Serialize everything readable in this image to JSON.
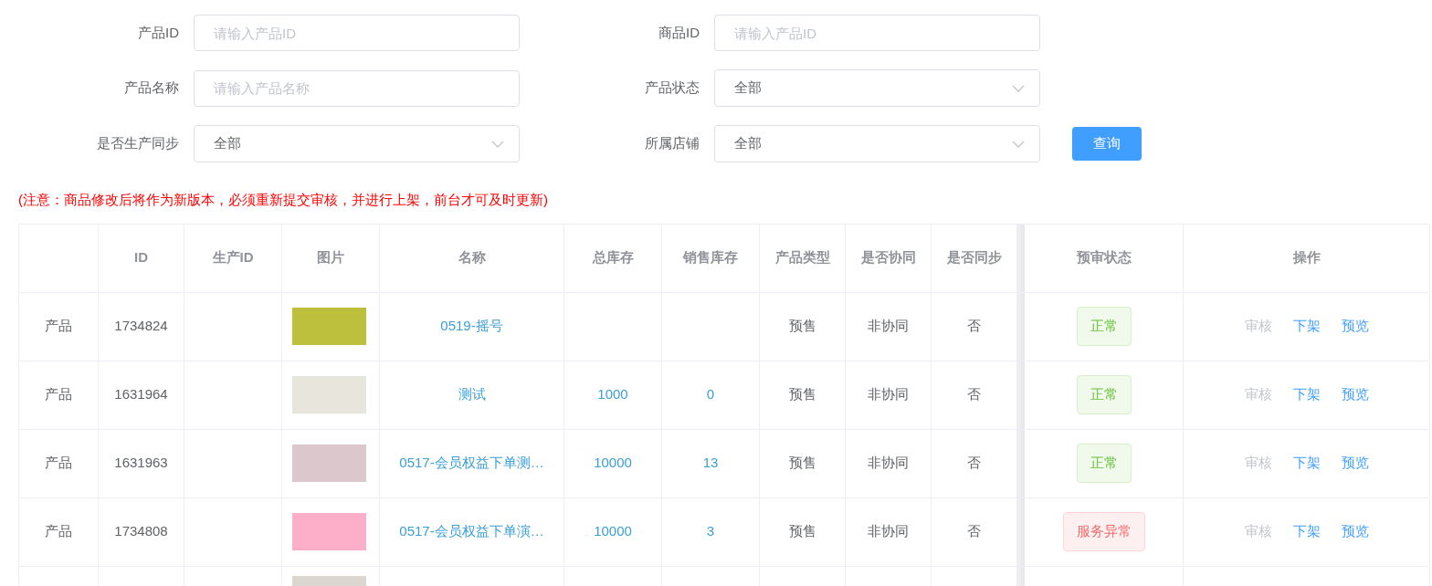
{
  "filters": [
    {
      "label": "产品ID",
      "kind": "input",
      "placeholder": "请输入产品ID"
    },
    {
      "label": "商品ID",
      "kind": "input",
      "placeholder": "请输入产品ID"
    },
    {
      "label": "产品名称",
      "kind": "input",
      "placeholder": "请输入产品名称"
    },
    {
      "label": "产品状态",
      "kind": "select",
      "value": "全部"
    },
    {
      "label": "是否生产同步",
      "kind": "select",
      "value": "全部"
    },
    {
      "label": "所属店铺",
      "kind": "select",
      "value": "全部"
    }
  ],
  "query_button": "查询",
  "notice": "(注意：商品修改后将作为新版本，必须重新提交审核，并进行上架，前台才可及时更新)",
  "table": {
    "columns": [
      "",
      "ID",
      "生产ID",
      "图片",
      "名称",
      "总库存",
      "销售库存",
      "产品类型",
      "是否协同",
      "是否同步",
      "预审状态",
      "操作"
    ],
    "rows": [
      {
        "type": "产品",
        "id": "1734824",
        "image": {
          "color": "#bcc03c"
        },
        "name": "0519-摇号",
        "total_stock": "",
        "sales_stock": "",
        "product_type": "预售",
        "collab": "非协同",
        "synced": "否",
        "status": {
          "label": "正常",
          "kind": "success"
        },
        "actions": [
          {
            "label": "审核",
            "disabled": true
          },
          {
            "label": "下架",
            "disabled": false
          },
          {
            "label": "预览",
            "disabled": false
          }
        ]
      },
      {
        "type": "产品",
        "id": "1631964",
        "image": {
          "color": "#e8e6dc"
        },
        "name": "测试",
        "total_stock": "1000",
        "sales_stock": "0",
        "product_type": "预售",
        "collab": "非协同",
        "synced": "否",
        "status": {
          "label": "正常",
          "kind": "success"
        },
        "actions": [
          {
            "label": "审核",
            "disabled": true
          },
          {
            "label": "下架",
            "disabled": false
          },
          {
            "label": "预览",
            "disabled": false
          }
        ]
      },
      {
        "type": "产品",
        "id": "1631963",
        "image": {
          "color": "#dcc8cc"
        },
        "name": "0517-会员权益下单测…",
        "total_stock": "10000",
        "sales_stock": "13",
        "product_type": "预售",
        "collab": "非协同",
        "synced": "否",
        "status": {
          "label": "正常",
          "kind": "success"
        },
        "actions": [
          {
            "label": "审核",
            "disabled": true
          },
          {
            "label": "下架",
            "disabled": false
          },
          {
            "label": "预览",
            "disabled": false
          }
        ]
      },
      {
        "type": "产品",
        "id": "1734808",
        "image": {
          "color": "#fdafc9"
        },
        "name": "0517-会员权益下单演…",
        "total_stock": "10000",
        "sales_stock": "3",
        "product_type": "预售",
        "collab": "非协同",
        "synced": "否",
        "status": {
          "label": "服务异常",
          "kind": "danger"
        },
        "actions": [
          {
            "label": "审核",
            "disabled": true
          },
          {
            "label": "下架",
            "disabled": false
          },
          {
            "label": "预览",
            "disabled": false
          }
        ]
      }
    ]
  }
}
